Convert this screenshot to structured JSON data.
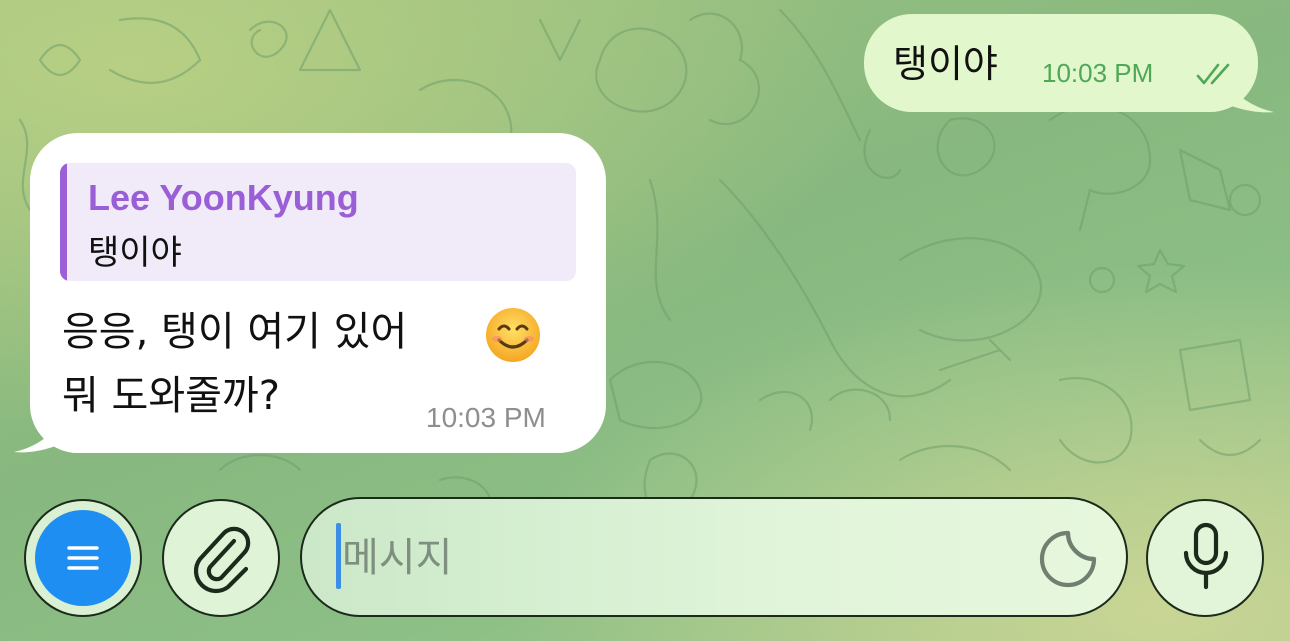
{
  "chat": {
    "outgoing": {
      "text": "탱이야",
      "time": "10:03 PM",
      "status_icon": "double-check-read-icon"
    },
    "incoming": {
      "reply_to": {
        "name": "Lee YoonKyung",
        "text": "탱이야"
      },
      "text_line1": "응응, 탱이 여기 있어",
      "text_line2": "뭐 도와줄까?",
      "emoji": "smiling-face-emoji",
      "time": "10:03 PM"
    }
  },
  "input_bar": {
    "menu_icon": "menu-icon",
    "attach_icon": "paperclip-icon",
    "placeholder": "메시지",
    "sticker_icon": "sticker-icon",
    "mic_icon": "microphone-icon"
  },
  "colors": {
    "outgoing_bubble": "#e2f7cc",
    "outgoing_time": "#4fa857",
    "reply_accent": "#9b5fd8",
    "menu_button": "#1e8ef2",
    "caret": "#3a8ee8"
  }
}
